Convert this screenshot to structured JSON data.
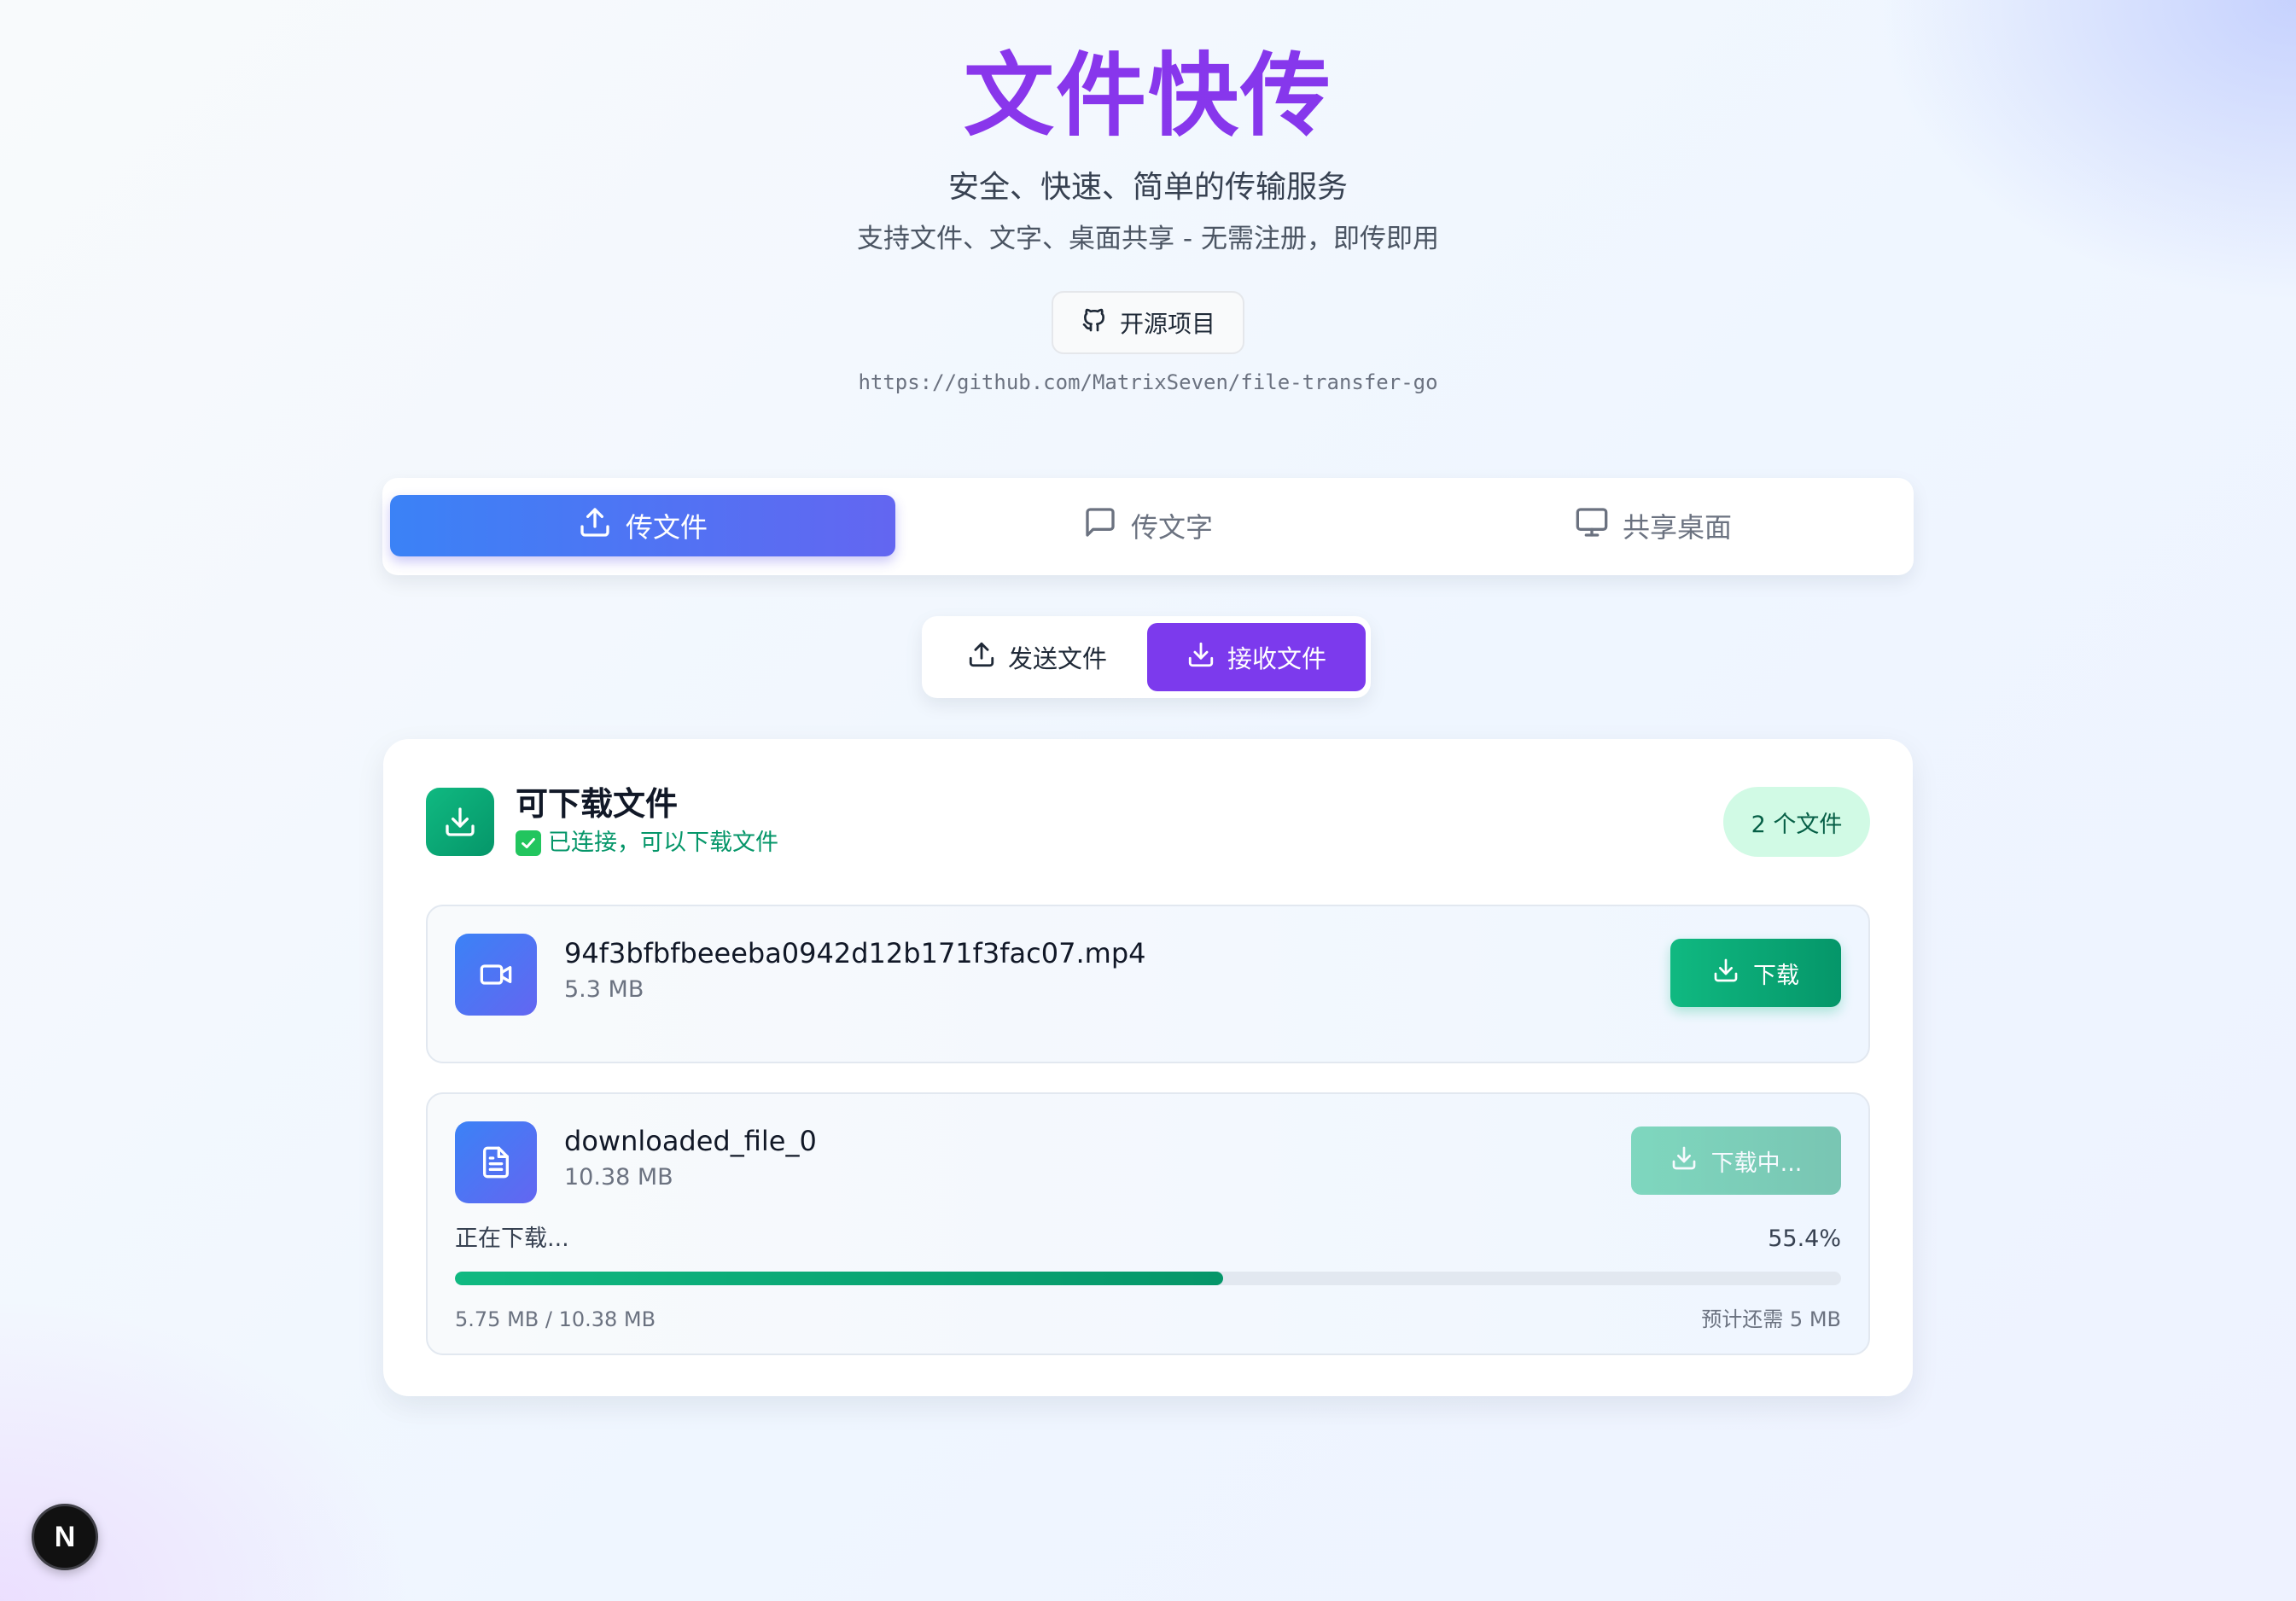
{
  "header": {
    "title": "文件快传",
    "subtitle": "安全、快速、简单的传输服务",
    "description": "支持文件、文字、桌面共享 - 无需注册，即传即用",
    "github_button": "开源项目",
    "github_url": "https://github.com/MatrixSeven/file-transfer-go"
  },
  "tabs": [
    {
      "label": "传文件",
      "icon": "upload-icon",
      "active": true
    },
    {
      "label": "传文字",
      "icon": "message-icon",
      "active": false
    },
    {
      "label": "共享桌面",
      "icon": "monitor-icon",
      "active": false
    }
  ],
  "mode_switch": {
    "send_label": "发送文件",
    "receive_label": "接收文件",
    "selected": "receive"
  },
  "download_panel": {
    "title": "可下载文件",
    "status": "已连接，可以下载文件",
    "count_badge": "2 个文件",
    "files": [
      {
        "name": "94f3bfbfbeeeba0942d12b171f3fac07.mp4",
        "size": "5.3 MB",
        "icon": "video-icon",
        "button": "下载",
        "state": "ready"
      },
      {
        "name": "downloaded_file_0",
        "size": "10.38 MB",
        "icon": "file-text-icon",
        "button": "下载中...",
        "state": "downloading",
        "progress_label": "正在下载...",
        "progress_percent_text": "55.4%",
        "progress": 0.554,
        "bytes": "5.75 MB / 10.38 MB",
        "eta": "预计还需 5 MB"
      }
    ]
  },
  "colors": {
    "title": "#9333ea",
    "tab_active_start": "#3b82f6",
    "tab_active_end": "#6366f1",
    "receive_active": "#7c3aed",
    "success": "#10b981",
    "badge_bg": "#d1fae5"
  },
  "dev_badge": "N"
}
